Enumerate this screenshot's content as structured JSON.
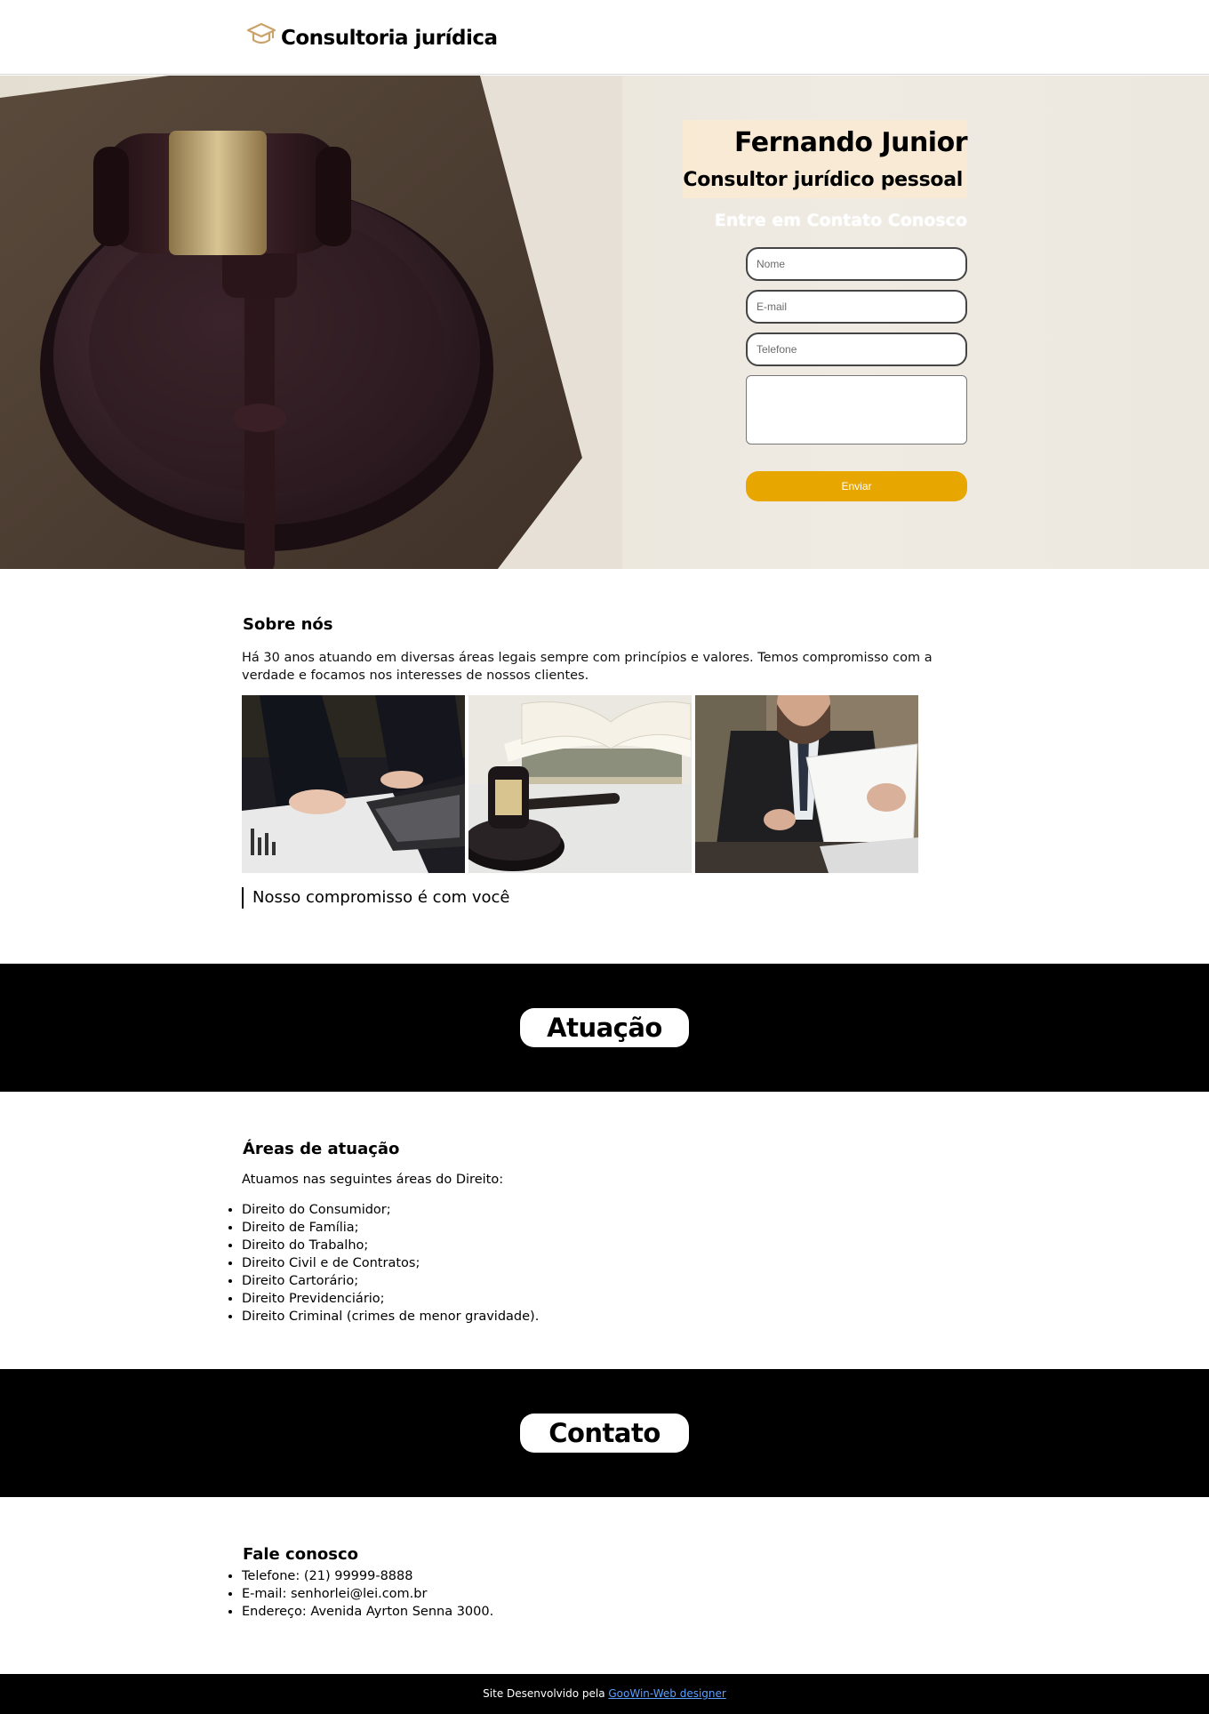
{
  "header": {
    "logo_icon": "graduation-cap-icon",
    "brand": "Consultoria jurídica"
  },
  "hero": {
    "name": "Fernando Junior",
    "subtitle": "Consultor jurídico pessoal",
    "contact_title": "Entre em Contato Conosco",
    "form": {
      "nome_placeholder": "Nome",
      "email_placeholder": "E-mail",
      "telefone_placeholder": "Telefone",
      "mensagem_placeholder": "",
      "submit_label": "Enviar"
    },
    "accent_color": "#e8a600"
  },
  "about": {
    "title": "Sobre nós",
    "text": "Há 30 anos atuando em diversas áreas legais sempre com princípios e valores. Temos compromisso com a verdade e focamos nos interesses de nossos clientes.",
    "quote": "Nosso compromisso é com você"
  },
  "bands": {
    "atuacao": "Atuação",
    "contato": "Contato"
  },
  "areas": {
    "title": "Áreas de atuação",
    "intro": "Atuamos nas seguintes áreas do Direito:",
    "items": [
      "Direito do Consumidor;",
      "Direito de Família;",
      "Direito do Trabalho;",
      "Direito Civil e de Contratos;",
      "Direito Cartorário;",
      "Direito Previdenciário;",
      "Direito Criminal (crimes de menor gravidade)."
    ]
  },
  "contact": {
    "title": "Fale conosco",
    "items": [
      "Telefone: (21) 99999-8888",
      "E-mail: senhorlei@lei.com.br",
      "Endereço: Avenida Ayrton Senna 3000."
    ]
  },
  "footer": {
    "prefix": "Site Desenvolvido pela ",
    "link_text": "GooWin-Web designer"
  }
}
